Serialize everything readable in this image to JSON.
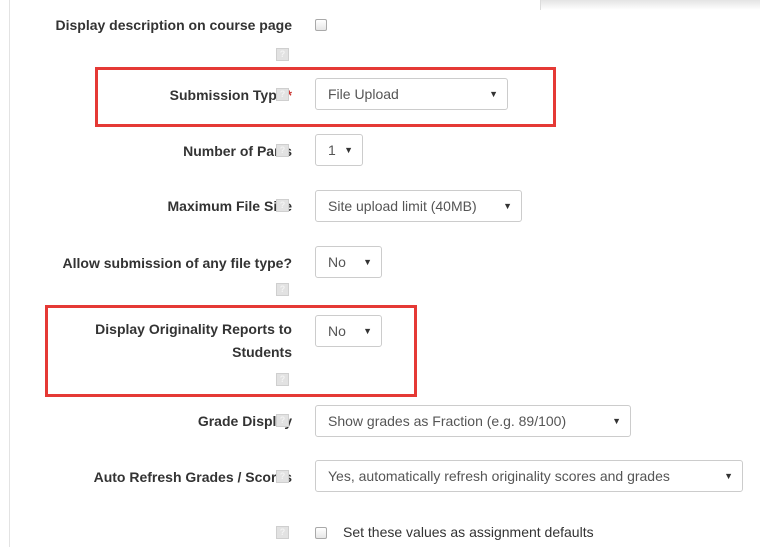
{
  "form": {
    "display_description": {
      "label": "Display description on course page",
      "checked": false
    },
    "submission_type": {
      "label": "Submission Type",
      "required_marker": "*",
      "value": "File Upload"
    },
    "number_of_parts": {
      "label": "Number of Parts",
      "value": "1"
    },
    "max_file_size": {
      "label": "Maximum File Size",
      "value": "Site upload limit (40MB)"
    },
    "allow_any_file_type": {
      "label": "Allow submission of any file type?",
      "value": "No"
    },
    "display_originality": {
      "label": "Display Originality Reports to Students",
      "value": "No"
    },
    "grade_display": {
      "label": "Grade Display",
      "value": "Show grades as Fraction (e.g. 89/100)"
    },
    "auto_refresh": {
      "label": "Auto Refresh Grades / Scores",
      "value": "Yes, automatically refresh originality scores and grades"
    },
    "set_defaults": {
      "label": "Set these values as assignment defaults",
      "checked": false
    }
  },
  "icons": {
    "help": "help-icon",
    "dropdown": "dropdown-arrow-icon"
  },
  "colors": {
    "highlight": "#e53935",
    "required": "#c9302c",
    "label_text": "#333333",
    "help_icon": "#e2e2e2"
  }
}
